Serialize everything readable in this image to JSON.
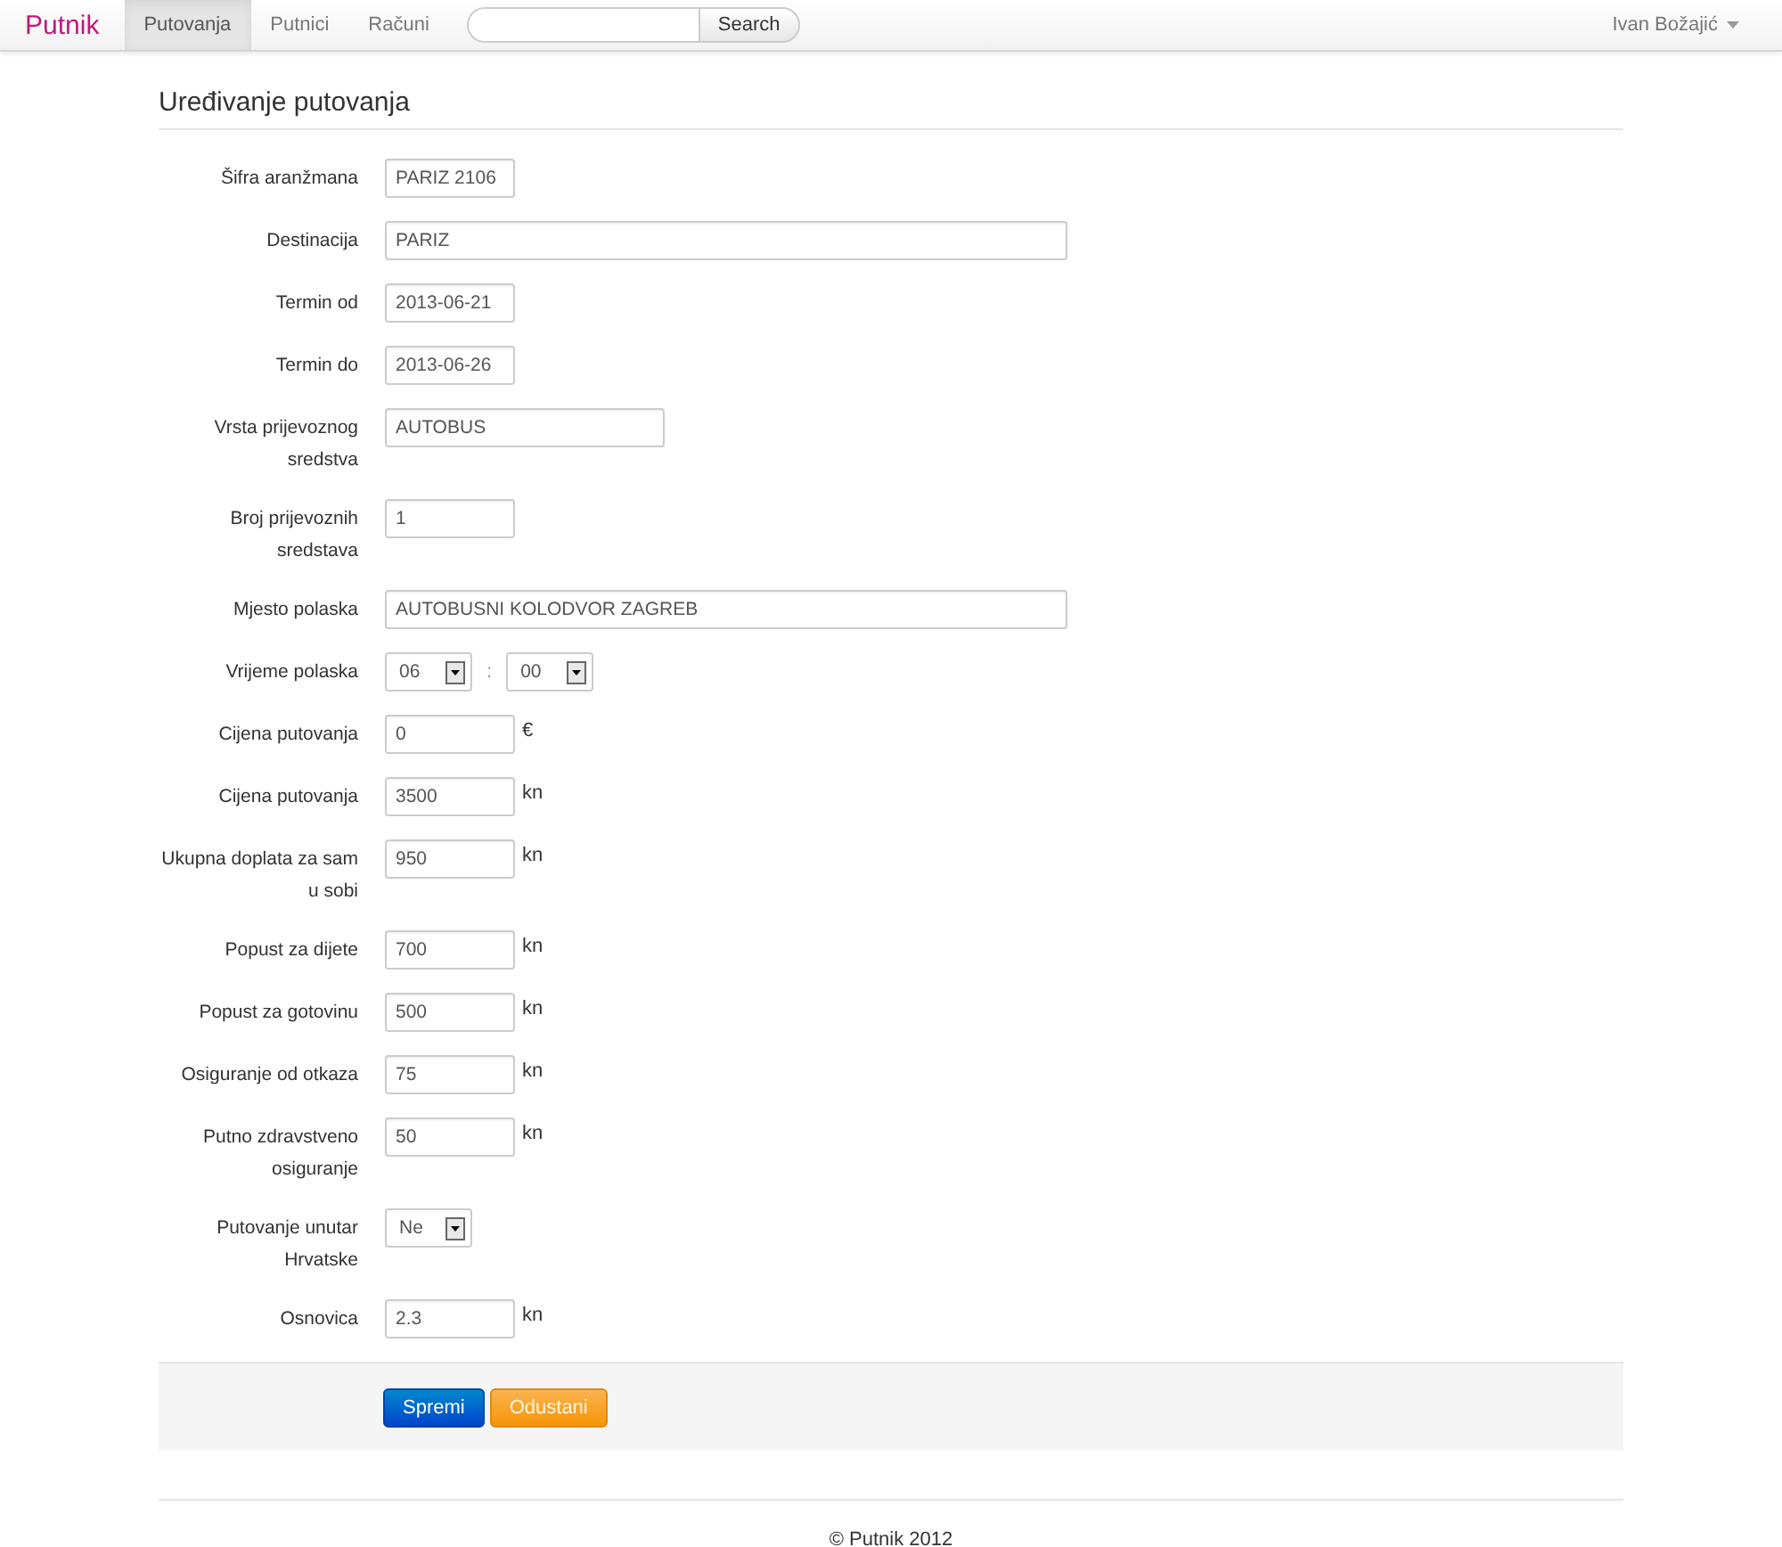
{
  "navbar": {
    "brand": "Putnik",
    "tabs": [
      {
        "label": "Putovanja",
        "selected": true
      },
      {
        "label": "Putnici",
        "selected": false
      },
      {
        "label": "Računi",
        "selected": false
      }
    ],
    "search": {
      "button": "Search"
    },
    "user": "Ivan Božajić"
  },
  "title": "Uređivanje putovanja",
  "fields": [
    {
      "label": "Šifra aranžmana",
      "kind": "short",
      "value": "PARIZ 2106"
    },
    {
      "label": "Destinacija",
      "kind": "wide",
      "value": "PARIZ"
    },
    {
      "label": "Termin od",
      "kind": "short",
      "value": "2013-06-21"
    },
    {
      "label": "Termin do",
      "kind": "short",
      "value": "2013-06-26"
    },
    {
      "label": "Vrsta prijevoznog sredstva",
      "kind": "medium",
      "value": "AUTOBUS"
    },
    {
      "label": "Broj prijevoznih sredstava",
      "kind": "short",
      "value": "1"
    },
    {
      "label": "Mjesto polaska",
      "kind": "wide",
      "value": "AUTOBUSNI KOLODVOR ZAGREB"
    },
    {
      "label": "Vrijeme polaska",
      "kind": "time",
      "hour": "06",
      "separator": ":",
      "minute": "00"
    },
    {
      "label": "Cijena putovanja",
      "kind": "short",
      "value": "0",
      "unit": "€"
    },
    {
      "label": "Cijena putovanja",
      "kind": "short",
      "value": "3500",
      "unit": "kn"
    },
    {
      "label": "Ukupna doplata za sam u sobi",
      "kind": "short",
      "value": "950",
      "unit": "kn"
    },
    {
      "label": "Popust za dijete",
      "kind": "short",
      "value": "700",
      "unit": "kn"
    },
    {
      "label": "Popust za gotovinu",
      "kind": "short",
      "value": "500",
      "unit": "kn"
    },
    {
      "label": "Osiguranje od otkaza",
      "kind": "short",
      "value": "75",
      "unit": "kn"
    },
    {
      "label": "Putno zdravstveno osiguranje",
      "kind": "short",
      "value": "50",
      "unit": "kn"
    },
    {
      "label": "Putovanje unutar Hrvatske",
      "kind": "select",
      "value": "Ne"
    },
    {
      "label": "Osnovica",
      "kind": "short",
      "value": "2.3",
      "unit": "kn"
    }
  ],
  "actions": [
    {
      "label": "Spremi",
      "kind": "primary"
    },
    {
      "label": "Odustani",
      "kind": "warning"
    }
  ],
  "footer": "© Putnik 2012"
}
